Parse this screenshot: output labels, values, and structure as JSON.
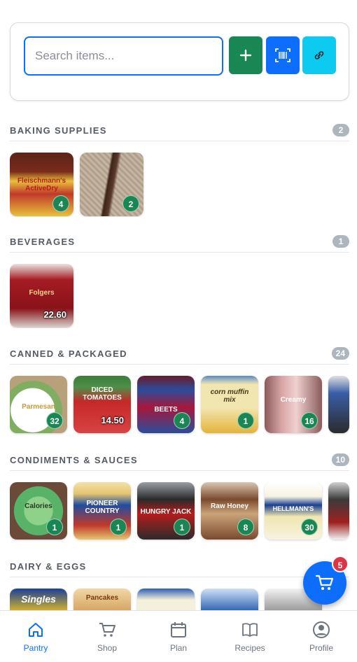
{
  "search": {
    "placeholder": "Search items..."
  },
  "toolbar": {
    "add_label": "+",
    "scan_icon": "barcode-icon",
    "link_icon": "link-icon"
  },
  "sections": [
    {
      "title": "BAKING SUPPLIES",
      "count": "2",
      "items": [
        {
          "qty": "4",
          "label": "Fleischmann's ActiveDry",
          "colors": [
            "#7a2b1c",
            "#e8c13a"
          ]
        },
        {
          "qty": "2",
          "label": "",
          "colors": [
            "#b8a898",
            "#5a3a2c"
          ]
        }
      ]
    },
    {
      "title": "BEVERAGES",
      "count": "1",
      "items": [
        {
          "qty": "22.60",
          "label": "Folgers",
          "colors": [
            "#a51c24",
            "#d8d2cc"
          ]
        }
      ]
    },
    {
      "title": "CANNED & PACKAGED",
      "count": "24",
      "items": [
        {
          "qty": "32",
          "label": "Parmesan",
          "colors": [
            "#f1f1f1",
            "#6aa84f"
          ]
        },
        {
          "qty": "14.50",
          "label": "DICED TOMATOES",
          "colors": [
            "#c62828",
            "#3b7d3b"
          ]
        },
        {
          "qty": "4",
          "label": "BEETS",
          "colors": [
            "#2a4d9b",
            "#a8173b"
          ]
        },
        {
          "qty": "1",
          "label": "corn muffin mix",
          "colors": [
            "#f2e6b0",
            "#e3b43a"
          ]
        },
        {
          "qty": "16",
          "label": "Creamy",
          "colors": [
            "#d9a6a6",
            "#8a5b5b"
          ]
        },
        {
          "qty": "",
          "label": "",
          "colors": [
            "#3a5ea8",
            "#e0e0e0"
          ]
        }
      ]
    },
    {
      "title": "CONDIMENTS & SAUCES",
      "count": "10",
      "items": [
        {
          "qty": "1",
          "label": "Calories",
          "colors": [
            "#58b368",
            "#2e7d4a"
          ]
        },
        {
          "qty": "1",
          "label": "PIONEER COUNTRY",
          "colors": [
            "#1f4ea1",
            "#e6c470"
          ]
        },
        {
          "qty": "1",
          "label": "HUNGRY JACK",
          "colors": [
            "#b71c1c",
            "#2b2b2b"
          ]
        },
        {
          "qty": "8",
          "label": "Raw Honey",
          "colors": [
            "#7b4a2e",
            "#d9c7b4"
          ]
        },
        {
          "qty": "30",
          "label": "HELLMANN'S",
          "colors": [
            "#f7f3e0",
            "#1b3f8f"
          ]
        },
        {
          "qty": "",
          "label": "",
          "colors": [
            "#3b3b3b",
            "#a02020"
          ]
        }
      ]
    },
    {
      "title": "DAIRY & EGGS",
      "count": "",
      "items": [
        {
          "qty": "",
          "label": "Singles",
          "colors": [
            "#1b3f99",
            "#f0c419"
          ]
        },
        {
          "qty": "",
          "label": "Pancakes",
          "colors": [
            "#f2d7a6",
            "#c58b3f"
          ]
        },
        {
          "qty": "",
          "label": "",
          "colors": [
            "#f5f0dc",
            "#2b5fb0"
          ]
        },
        {
          "qty": "",
          "label": "",
          "colors": [
            "#cfe0f5",
            "#2c62b5"
          ]
        },
        {
          "qty": "",
          "label": "",
          "colors": [
            "#f2f2f2",
            "#6a6a6a"
          ]
        }
      ]
    }
  ],
  "cart": {
    "badge": "5",
    "icon": "cart-icon"
  },
  "nav": [
    {
      "label": "Pantry",
      "icon": "home-icon",
      "active": true
    },
    {
      "label": "Shop",
      "icon": "cart-icon",
      "active": false
    },
    {
      "label": "Plan",
      "icon": "calendar-icon",
      "active": false
    },
    {
      "label": "Recipes",
      "icon": "book-icon",
      "active": false
    },
    {
      "label": "Profile",
      "icon": "user-circle-icon",
      "active": false
    }
  ],
  "colors": {
    "primary": "#0d6efd",
    "success": "#198754",
    "info": "#0dcaf0",
    "danger": "#dc3545",
    "muted": "#adb5bd"
  }
}
